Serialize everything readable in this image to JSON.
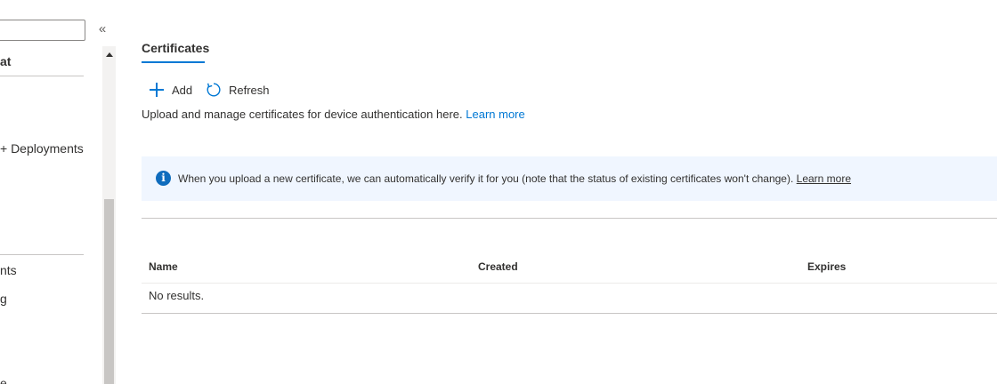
{
  "nav": {
    "items": [
      {
        "label": "at",
        "bold": true
      },
      {
        "label": "+ Deployments",
        "bold": false
      },
      {
        "label": "nts",
        "bold": false
      },
      {
        "label": "g",
        "bold": false
      },
      {
        "label": "e",
        "bold": false
      }
    ],
    "collapse_glyph": "«"
  },
  "main": {
    "tab_label": "Certificates",
    "commands": {
      "add_label": "Add",
      "refresh_label": "Refresh"
    },
    "description": "Upload and manage certificates for device authentication here.",
    "description_link": "Learn more",
    "banner": {
      "icon": "info-icon",
      "text": "When you upload a new certificate, we can automatically verify it for you (note that the status of existing certificates won't change).",
      "link": " Learn more"
    },
    "table": {
      "columns": [
        "Name",
        "Created",
        "Expires"
      ],
      "empty_text": "No results."
    }
  },
  "colors": {
    "accent": "#0078d4",
    "banner_bg": "#f0f6ff"
  }
}
